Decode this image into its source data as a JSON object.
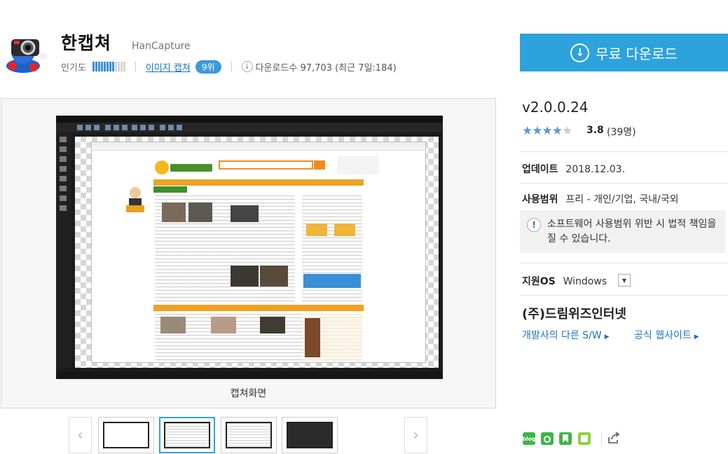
{
  "app": {
    "title": "한캡쳐",
    "english_name": "HanCapture",
    "popularity_label": "인기도",
    "popularity_level": 0.7,
    "category_link": "이미지 캡쳐",
    "rank_badge": "9위",
    "download_count": "다운로드수 97,703 (최근 7일:184)"
  },
  "download_button": {
    "label": "무료 다운로드",
    "icon": "download-circle-icon",
    "color": "#2ea2dc"
  },
  "viewer": {
    "caption": "캡쳐화면",
    "prev_arrow": "‹",
    "next_arrow": "›",
    "thumbnails": [
      {
        "type": "blank",
        "active": false
      },
      {
        "type": "web",
        "active": true
      },
      {
        "type": "web",
        "active": false
      },
      {
        "type": "dark",
        "active": false
      }
    ]
  },
  "details": {
    "version": "v2.0.0.24",
    "rating": {
      "stars": 4,
      "max": 5,
      "value": "3.8",
      "count": "(39명)"
    },
    "update_label": "업데이트",
    "update_value": "2018.12.03.",
    "license_label": "사용범위",
    "license_value": "프리 - 개인/기업, 국내/국외",
    "notice_icon": "!",
    "notice_text": "소프트웨어 사용범위 위반 시 법적 책임을 질 수 있습니다.",
    "os_label": "지원OS",
    "os_value": "Windows",
    "company": "(주)드림위즈인터넷",
    "developer_link": "개발사의 다른 S/W",
    "website_link": "공식 웹사이트"
  },
  "share": {
    "icons": [
      {
        "name": "blog-share-icon",
        "text": "blog",
        "color": "#3cb548"
      },
      {
        "name": "cafe-share-icon",
        "text": "",
        "color": "#3cb548"
      },
      {
        "name": "bookmark-share-icon",
        "text": "",
        "color": "#3cb548"
      },
      {
        "name": "memo-share-icon",
        "text": "",
        "color": "#8ed13c"
      }
    ]
  }
}
